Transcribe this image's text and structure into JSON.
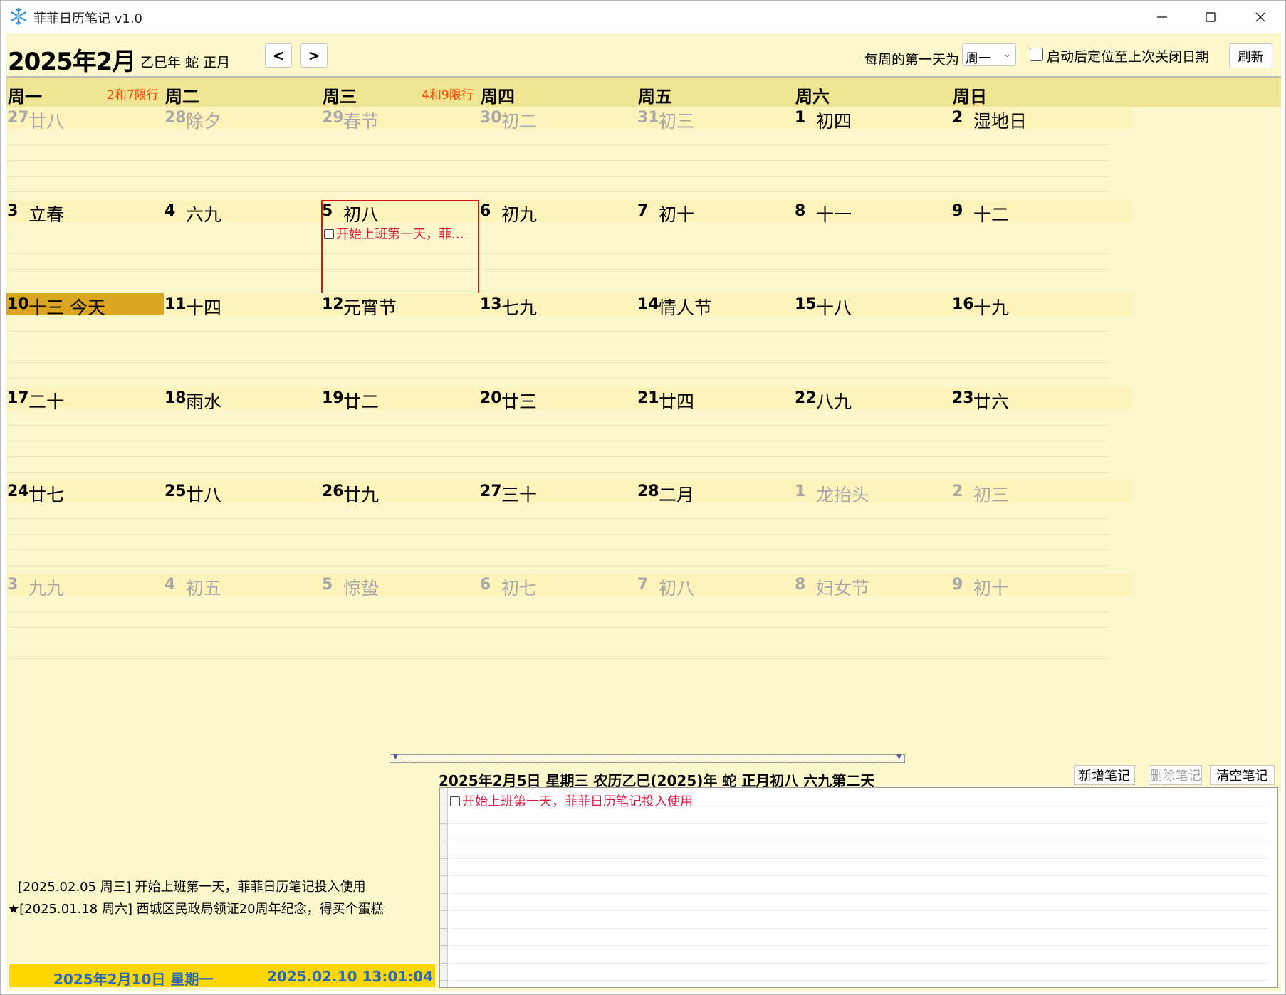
{
  "window": {
    "title": "菲菲日历笔记 v1.0",
    "icon": "snowflake-icon",
    "minimize_icon": "minimize-icon",
    "maximize_icon": "maximize-icon",
    "close_icon": "close-icon"
  },
  "header": {
    "month_title": "2025年2月",
    "lunar_year": "乙巳年 蛇 正月",
    "prev_label": "<",
    "next_label": ">",
    "week_start_label": "每周的第一天为",
    "week_start_value": "周一",
    "restore_label": "启动后定位至上次关闭日期",
    "restore_checked": false,
    "refresh_label": "刷新"
  },
  "weekdays": [
    {
      "name": "周一",
      "limit": "2和7限行"
    },
    {
      "name": "周二",
      "limit": ""
    },
    {
      "name": "周三",
      "limit": "4和9限行"
    },
    {
      "name": "周四",
      "limit": ""
    },
    {
      "name": "周五",
      "limit": ""
    },
    {
      "name": "周六",
      "limit": ""
    },
    {
      "name": "周日",
      "limit": ""
    }
  ],
  "weeks": [
    [
      {
        "day": "27",
        "lunar": "廿八",
        "dim": true,
        "gap": false
      },
      {
        "day": "28",
        "lunar": "除夕",
        "dim": true,
        "gap": false
      },
      {
        "day": "29",
        "lunar": "春节",
        "dim": true,
        "gap": false
      },
      {
        "day": "30",
        "lunar": "初二",
        "dim": true,
        "gap": false
      },
      {
        "day": "31",
        "lunar": "初三",
        "dim": true,
        "gap": false
      },
      {
        "day": "1",
        "lunar": "初四",
        "dim": false,
        "gap": true
      },
      {
        "day": "2",
        "lunar": "湿地日",
        "dim": false,
        "gap": true
      }
    ],
    [
      {
        "day": "3",
        "lunar": "立春",
        "dim": false,
        "gap": true
      },
      {
        "day": "4",
        "lunar": "六九",
        "dim": false,
        "gap": true
      },
      {
        "day": "5",
        "lunar": "初八",
        "dim": false,
        "gap": true,
        "selected": true,
        "note": "开始上班第一天，菲..."
      },
      {
        "day": "6",
        "lunar": "初九",
        "dim": false,
        "gap": true
      },
      {
        "day": "7",
        "lunar": "初十",
        "dim": false,
        "gap": true
      },
      {
        "day": "8",
        "lunar": "十一",
        "dim": false,
        "gap": true
      },
      {
        "day": "9",
        "lunar": "十二",
        "dim": false,
        "gap": true
      }
    ],
    [
      {
        "day": "10",
        "lunar": "十三  今天",
        "dim": false,
        "gap": false,
        "today": true
      },
      {
        "day": "11",
        "lunar": "十四",
        "dim": false,
        "gap": false
      },
      {
        "day": "12",
        "lunar": "元宵节",
        "dim": false,
        "gap": false
      },
      {
        "day": "13",
        "lunar": "七九",
        "dim": false,
        "gap": false
      },
      {
        "day": "14",
        "lunar": "情人节",
        "dim": false,
        "gap": false
      },
      {
        "day": "15",
        "lunar": "十八",
        "dim": false,
        "gap": false
      },
      {
        "day": "16",
        "lunar": "十九",
        "dim": false,
        "gap": false
      }
    ],
    [
      {
        "day": "17",
        "lunar": "二十",
        "dim": false,
        "gap": false
      },
      {
        "day": "18",
        "lunar": "雨水",
        "dim": false,
        "gap": false
      },
      {
        "day": "19",
        "lunar": "廿二",
        "dim": false,
        "gap": false
      },
      {
        "day": "20",
        "lunar": "廿三",
        "dim": false,
        "gap": false
      },
      {
        "day": "21",
        "lunar": "廿四",
        "dim": false,
        "gap": false
      },
      {
        "day": "22",
        "lunar": "八九",
        "dim": false,
        "gap": false
      },
      {
        "day": "23",
        "lunar": "廿六",
        "dim": false,
        "gap": false
      }
    ],
    [
      {
        "day": "24",
        "lunar": "廿七",
        "dim": false,
        "gap": false
      },
      {
        "day": "25",
        "lunar": "廿八",
        "dim": false,
        "gap": false
      },
      {
        "day": "26",
        "lunar": "廿九",
        "dim": false,
        "gap": false
      },
      {
        "day": "27",
        "lunar": "三十",
        "dim": false,
        "gap": false
      },
      {
        "day": "28",
        "lunar": "二月",
        "dim": false,
        "gap": false
      },
      {
        "day": "1",
        "lunar": "龙抬头",
        "dim": true,
        "gap": true
      },
      {
        "day": "2",
        "lunar": "初三",
        "dim": true,
        "gap": true
      }
    ],
    [
      {
        "day": "3",
        "lunar": "九九",
        "dim": true,
        "gap": true
      },
      {
        "day": "4",
        "lunar": "初五",
        "dim": true,
        "gap": true
      },
      {
        "day": "5",
        "lunar": "惊蛰",
        "dim": true,
        "gap": true
      },
      {
        "day": "6",
        "lunar": "初七",
        "dim": true,
        "gap": true
      },
      {
        "day": "7",
        "lunar": "初八",
        "dim": true,
        "gap": true
      },
      {
        "day": "8",
        "lunar": "妇女节",
        "dim": true,
        "gap": true
      },
      {
        "day": "9",
        "lunar": "初十",
        "dim": true,
        "gap": true
      }
    ]
  ],
  "reminders": [
    "[2025.02.05 周三] 开始上班第一天，菲菲日历笔记投入使用",
    "★[2025.01.18 周六] 西城区民政局领证20周年纪念，得买个蛋糕"
  ],
  "status": {
    "date": "2025年2月10日 星期一",
    "clock": "2025.02.10 13:01:04"
  },
  "detail": {
    "title": "2025年2月5日 星期三 农历乙巳(2025)年 蛇 正月初八 六九第二天",
    "add_label": "新增笔记",
    "delete_label": "删除笔记",
    "clear_label": "清空笔记",
    "note": "开始上班第一天，菲菲日历笔记投入使用"
  },
  "colors": {
    "background": "#fdf8cc",
    "weekday_header": "#efe592",
    "date_bar": "#fff3bc",
    "today": "#daa520",
    "note_text": "#dc143c",
    "limit_text": "#ff4500",
    "status_bar": "#ffd700",
    "status_text": "#2a6ab8",
    "selection": "#e01010"
  }
}
